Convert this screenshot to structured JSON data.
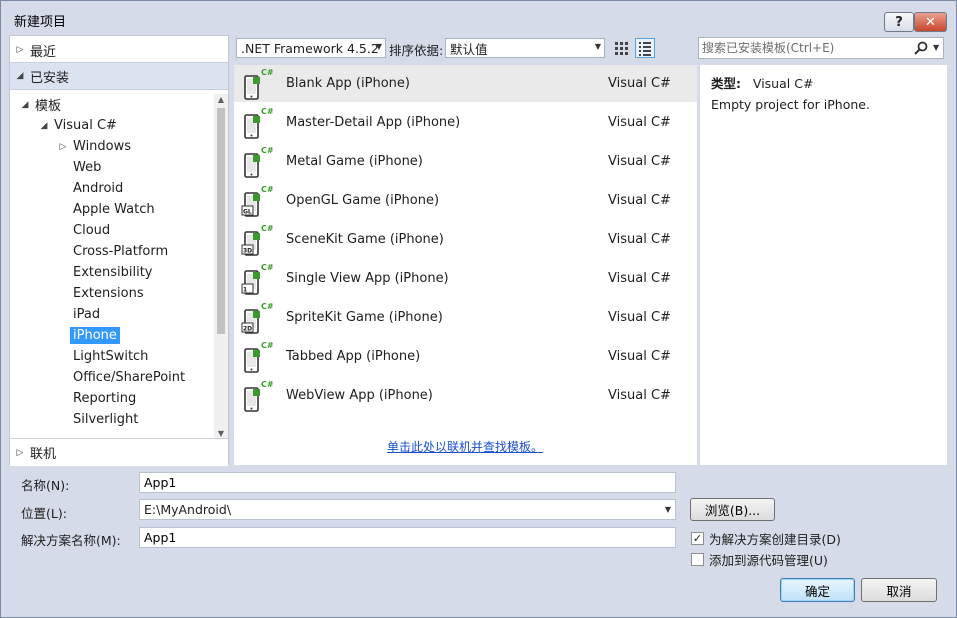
{
  "window": {
    "title": "新建项目",
    "help_label": "?",
    "close_label": "✕"
  },
  "left": {
    "recent": "最近",
    "installed": "已安装",
    "online": "联机",
    "tree": [
      {
        "label": "模板",
        "arrow": "◢",
        "indent": 0
      },
      {
        "label": "Visual C#",
        "arrow": "◢",
        "indent": 1
      },
      {
        "label": "Windows",
        "arrow": "▷",
        "indent": 2
      },
      {
        "label": "Web",
        "arrow": "",
        "indent": 2
      },
      {
        "label": "Android",
        "arrow": "",
        "indent": 2
      },
      {
        "label": "Apple Watch",
        "arrow": "",
        "indent": 2
      },
      {
        "label": "Cloud",
        "arrow": "",
        "indent": 2
      },
      {
        "label": "Cross-Platform",
        "arrow": "",
        "indent": 2
      },
      {
        "label": "Extensibility",
        "arrow": "",
        "indent": 2
      },
      {
        "label": "Extensions",
        "arrow": "",
        "indent": 2
      },
      {
        "label": "iPad",
        "arrow": "",
        "indent": 2
      },
      {
        "label": "iPhone",
        "arrow": "",
        "indent": 2,
        "selected": true
      },
      {
        "label": "LightSwitch",
        "arrow": "",
        "indent": 2
      },
      {
        "label": "Office/SharePoint",
        "arrow": "",
        "indent": 2
      },
      {
        "label": "Reporting",
        "arrow": "",
        "indent": 2
      },
      {
        "label": "Silverlight",
        "arrow": "",
        "indent": 2
      }
    ]
  },
  "toolbar": {
    "framework": ".NET Framework 4.5.2",
    "sort_label": "排序依据:",
    "sort_value": "默认值",
    "search_placeholder": "搜索已安装模板(Ctrl+E)"
  },
  "templates": [
    {
      "name": "Blank App (iPhone)",
      "lang": "Visual C#",
      "badge": "",
      "selected": true
    },
    {
      "name": "Master-Detail App (iPhone)",
      "lang": "Visual C#",
      "badge": ""
    },
    {
      "name": "Metal Game (iPhone)",
      "lang": "Visual C#",
      "badge": ""
    },
    {
      "name": "OpenGL Game (iPhone)",
      "lang": "Visual C#",
      "badge": "GL"
    },
    {
      "name": "SceneKit Game (iPhone)",
      "lang": "Visual C#",
      "badge": "3D"
    },
    {
      "name": "Single View App (iPhone)",
      "lang": "Visual C#",
      "badge": "1"
    },
    {
      "name": "SpriteKit Game (iPhone)",
      "lang": "Visual C#",
      "badge": "2D"
    },
    {
      "name": "Tabbed App (iPhone)",
      "lang": "Visual C#",
      "badge": ""
    },
    {
      "name": "WebView App (iPhone)",
      "lang": "Visual C#",
      "badge": ""
    }
  ],
  "icon_badge": "C#",
  "online_link": "单击此处以联机并查找模板。",
  "description": {
    "type_label": "类型:",
    "type_value": "Visual C#",
    "text": "Empty project for iPhone."
  },
  "form": {
    "name_label": "名称(N):",
    "name_value": "App1",
    "location_label": "位置(L):",
    "location_value": "E:\\MyAndroid\\",
    "solution_label": "解决方案名称(M):",
    "solution_value": "App1",
    "browse_label": "浏览(B)...",
    "create_dir_label": "为解决方案创建目录(D)",
    "create_dir_checked": true,
    "source_control_label": "添加到源代码管理(U)",
    "source_control_checked": false,
    "ok_label": "确定",
    "cancel_label": "取消"
  },
  "colors": {
    "accent": "#3399ff",
    "csharp_green": "#3a9a2a",
    "link": "#1a4fd1"
  }
}
